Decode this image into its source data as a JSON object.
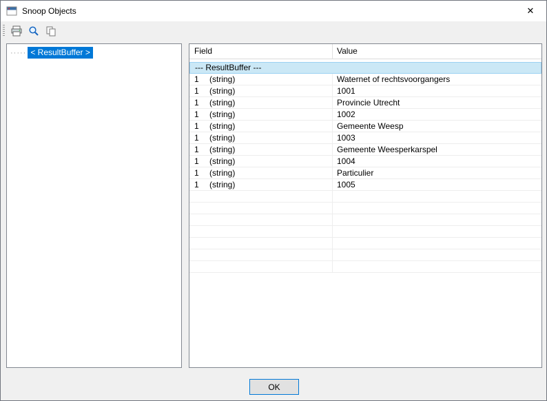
{
  "window": {
    "title": "Snoop Objects",
    "close_glyph": "✕"
  },
  "toolbar": {
    "icons": [
      "print",
      "preview",
      "copy"
    ]
  },
  "tree": {
    "connector": "·····",
    "root_label": "< ResultBuffer >"
  },
  "table": {
    "columns": [
      "Field",
      "Value"
    ],
    "group_row": "--- ResultBuffer ---",
    "rows": [
      {
        "field": "1",
        "type": "(string)",
        "value": "Waternet of rechtsvoorgangers"
      },
      {
        "field": "1",
        "type": "(string)",
        "value": "1001"
      },
      {
        "field": "1",
        "type": "(string)",
        "value": "Provincie Utrecht"
      },
      {
        "field": "1",
        "type": "(string)",
        "value": "1002"
      },
      {
        "field": "1",
        "type": "(string)",
        "value": "Gemeente Weesp"
      },
      {
        "field": "1",
        "type": "(string)",
        "value": "1003"
      },
      {
        "field": "1",
        "type": "(string)",
        "value": "Gemeente Weesperkarspel"
      },
      {
        "field": "1",
        "type": "(string)",
        "value": "1004"
      },
      {
        "field": "1",
        "type": "(string)",
        "value": "Particulier"
      },
      {
        "field": "1",
        "type": "(string)",
        "value": "1005"
      }
    ]
  },
  "footer": {
    "ok_label": "OK"
  },
  "colors": {
    "selection": "#0078d7",
    "row_selected_bg": "#cbe8f6",
    "row_selected_border": "#9bd1f2",
    "dialog_bg": "#f0f0f0",
    "grid_line": "#ededed"
  }
}
